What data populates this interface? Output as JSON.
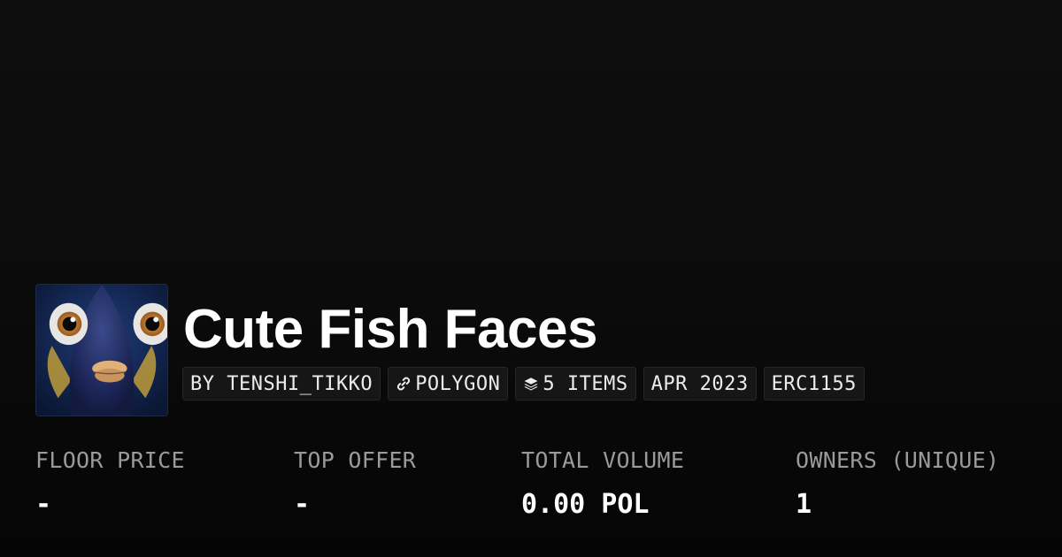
{
  "collection": {
    "name": "Cute Fish Faces",
    "avatar_icon": "fish-face-avatar"
  },
  "tags": {
    "creator": "BY TENSHI_TIKKO",
    "chain": "POLYGON",
    "chain_icon": "link-icon",
    "items": "5 ITEMS",
    "items_icon": "layers-icon",
    "date": "APR 2023",
    "standard": "ERC1155"
  },
  "stats": {
    "floor_price": {
      "label": "FLOOR PRICE",
      "value": "-"
    },
    "top_offer": {
      "label": "TOP OFFER",
      "value": "-"
    },
    "total_volume": {
      "label": "TOTAL VOLUME",
      "value": "0.00 POL"
    },
    "owners": {
      "label": "OWNERS (UNIQUE)",
      "value": "1"
    }
  },
  "colors": {
    "background": "#0b0b0b",
    "tag_background": "#161616",
    "label_text": "#9a9a9a",
    "value_text": "#ffffff"
  }
}
